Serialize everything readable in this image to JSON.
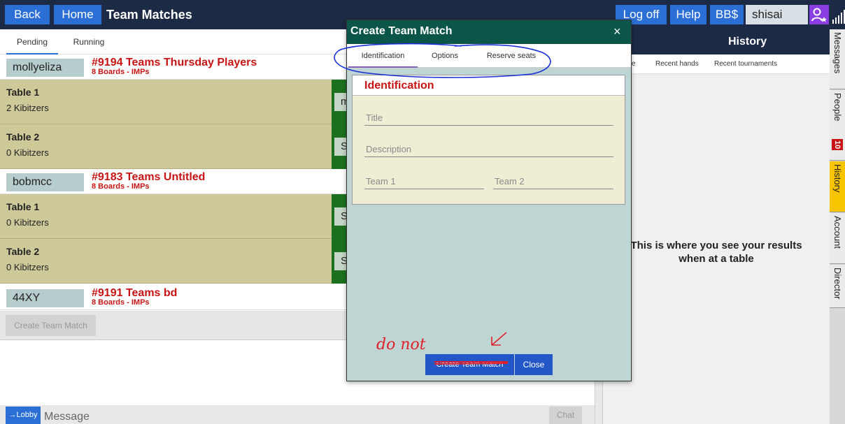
{
  "topbar": {
    "back": "Back",
    "home": "Home",
    "title": "Team Matches",
    "logoff": "Log off",
    "help": "Help",
    "bbs": "BB$",
    "username": "shisai"
  },
  "lobby": {
    "tabs": [
      "Pending",
      "Running"
    ],
    "matches": [
      {
        "host": "mollyeliza",
        "title": "#9194 Teams Thursday Players",
        "subtitle": "8 Boards - IMPs",
        "tables": [
          {
            "name": "Table 1",
            "kibitzers": "2 Kibitzers",
            "seat": "m"
          },
          {
            "name": "Table 2",
            "kibitzers": "0 Kibitzers",
            "seat": "S"
          }
        ]
      },
      {
        "host": "bobmcc",
        "title": "#9183 Teams Untitled",
        "subtitle": "8 Boards - IMPs",
        "tables": [
          {
            "name": "Table 1",
            "kibitzers": "0 Kibitzers",
            "seat": "S"
          },
          {
            "name": "Table 2",
            "kibitzers": "0 Kibitzers",
            "seat": "S"
          }
        ]
      },
      {
        "host": "44XY",
        "title": "#9191 Teams bd",
        "subtitle": "8 Boards - IMPs",
        "tables": []
      }
    ],
    "create_button": "Create Team Match"
  },
  "chat": {
    "lobby_button": "→Lobby",
    "placeholder": "Message",
    "chat_button": "Chat"
  },
  "history": {
    "title": "History",
    "tabs": [
      "e",
      "Recent hands",
      "Recent tournaments"
    ],
    "empty_message": "This is where you see your results when at a table"
  },
  "side_tabs": {
    "messages": "Messages",
    "people": "People",
    "people_count": "10",
    "history": "History",
    "account": "Account",
    "director": "Director"
  },
  "dialog": {
    "title": "Create Team Match",
    "close_icon": "×",
    "tabs": [
      "Identification",
      "Options",
      "Reserve seats"
    ],
    "section_title": "Identification",
    "fields": {
      "title": "Title",
      "description": "Description",
      "team1": "Team 1",
      "team2": "Team 2"
    },
    "create_button": "Create Team Match",
    "close_button": "Close"
  },
  "annotation": {
    "note": "do not",
    "color_ink": "#1a2fd6",
    "color_note": "#e0202a"
  },
  "colors": {
    "topbar": "#1c2a45",
    "button_blue": "#2b6fd6",
    "dialog_header": "#0b5549",
    "dialog_body": "#bfd5d3",
    "table_row": "#cdc999",
    "seat_green": "#1d7020",
    "match_red": "#c81414",
    "history_tab_active": "#f7c400"
  }
}
